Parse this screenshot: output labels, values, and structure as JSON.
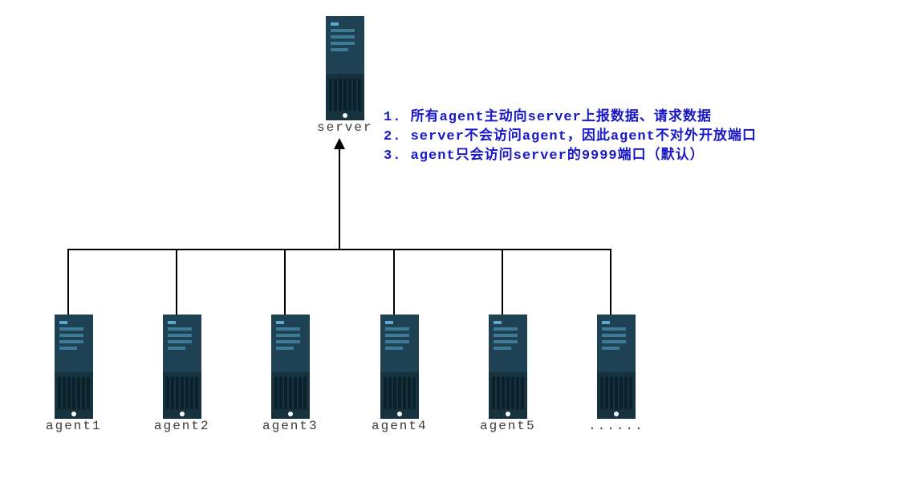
{
  "server": {
    "label": "server"
  },
  "agents": [
    {
      "label": "agent1"
    },
    {
      "label": "agent2"
    },
    {
      "label": "agent3"
    },
    {
      "label": "agent4"
    },
    {
      "label": "agent5"
    },
    {
      "label": "......"
    }
  ],
  "notes": {
    "line1": "1. 所有agent主动向server上报数据、请求数据",
    "line2": "2. server不会访问agent，因此agent不对外开放端口",
    "line3": "3. agent只会访问server的9999端口（默认）"
  },
  "colors": {
    "note_color": "#1818c8",
    "server_fill": "#1b3a4b",
    "line_color": "#000000"
  },
  "diagram_meta": {
    "topology": "star",
    "center": "server",
    "leaf_count": 6,
    "direction": "agents report upward to server"
  }
}
